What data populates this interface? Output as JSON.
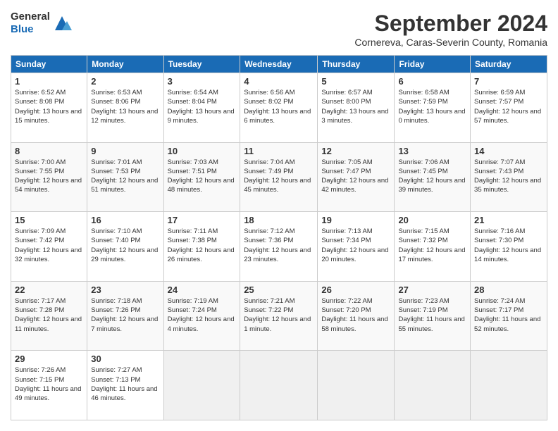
{
  "logo": {
    "general": "General",
    "blue": "Blue"
  },
  "title": "September 2024",
  "subtitle": "Cornereva, Caras-Severin County, Romania",
  "days_of_week": [
    "Sunday",
    "Monday",
    "Tuesday",
    "Wednesday",
    "Thursday",
    "Friday",
    "Saturday"
  ],
  "weeks": [
    [
      {
        "day": "1",
        "sunrise": "6:52 AM",
        "sunset": "8:08 PM",
        "daylight": "13 hours and 15 minutes."
      },
      {
        "day": "2",
        "sunrise": "6:53 AM",
        "sunset": "8:06 PM",
        "daylight": "13 hours and 12 minutes."
      },
      {
        "day": "3",
        "sunrise": "6:54 AM",
        "sunset": "8:04 PM",
        "daylight": "13 hours and 9 minutes."
      },
      {
        "day": "4",
        "sunrise": "6:56 AM",
        "sunset": "8:02 PM",
        "daylight": "13 hours and 6 minutes."
      },
      {
        "day": "5",
        "sunrise": "6:57 AM",
        "sunset": "8:00 PM",
        "daylight": "13 hours and 3 minutes."
      },
      {
        "day": "6",
        "sunrise": "6:58 AM",
        "sunset": "7:59 PM",
        "daylight": "13 hours and 0 minutes."
      },
      {
        "day": "7",
        "sunrise": "6:59 AM",
        "sunset": "7:57 PM",
        "daylight": "12 hours and 57 minutes."
      }
    ],
    [
      {
        "day": "8",
        "sunrise": "7:00 AM",
        "sunset": "7:55 PM",
        "daylight": "12 hours and 54 minutes."
      },
      {
        "day": "9",
        "sunrise": "7:01 AM",
        "sunset": "7:53 PM",
        "daylight": "12 hours and 51 minutes."
      },
      {
        "day": "10",
        "sunrise": "7:03 AM",
        "sunset": "7:51 PM",
        "daylight": "12 hours and 48 minutes."
      },
      {
        "day": "11",
        "sunrise": "7:04 AM",
        "sunset": "7:49 PM",
        "daylight": "12 hours and 45 minutes."
      },
      {
        "day": "12",
        "sunrise": "7:05 AM",
        "sunset": "7:47 PM",
        "daylight": "12 hours and 42 minutes."
      },
      {
        "day": "13",
        "sunrise": "7:06 AM",
        "sunset": "7:45 PM",
        "daylight": "12 hours and 39 minutes."
      },
      {
        "day": "14",
        "sunrise": "7:07 AM",
        "sunset": "7:43 PM",
        "daylight": "12 hours and 35 minutes."
      }
    ],
    [
      {
        "day": "15",
        "sunrise": "7:09 AM",
        "sunset": "7:42 PM",
        "daylight": "12 hours and 32 minutes."
      },
      {
        "day": "16",
        "sunrise": "7:10 AM",
        "sunset": "7:40 PM",
        "daylight": "12 hours and 29 minutes."
      },
      {
        "day": "17",
        "sunrise": "7:11 AM",
        "sunset": "7:38 PM",
        "daylight": "12 hours and 26 minutes."
      },
      {
        "day": "18",
        "sunrise": "7:12 AM",
        "sunset": "7:36 PM",
        "daylight": "12 hours and 23 minutes."
      },
      {
        "day": "19",
        "sunrise": "7:13 AM",
        "sunset": "7:34 PM",
        "daylight": "12 hours and 20 minutes."
      },
      {
        "day": "20",
        "sunrise": "7:15 AM",
        "sunset": "7:32 PM",
        "daylight": "12 hours and 17 minutes."
      },
      {
        "day": "21",
        "sunrise": "7:16 AM",
        "sunset": "7:30 PM",
        "daylight": "12 hours and 14 minutes."
      }
    ],
    [
      {
        "day": "22",
        "sunrise": "7:17 AM",
        "sunset": "7:28 PM",
        "daylight": "12 hours and 11 minutes."
      },
      {
        "day": "23",
        "sunrise": "7:18 AM",
        "sunset": "7:26 PM",
        "daylight": "12 hours and 7 minutes."
      },
      {
        "day": "24",
        "sunrise": "7:19 AM",
        "sunset": "7:24 PM",
        "daylight": "12 hours and 4 minutes."
      },
      {
        "day": "25",
        "sunrise": "7:21 AM",
        "sunset": "7:22 PM",
        "daylight": "12 hours and 1 minute."
      },
      {
        "day": "26",
        "sunrise": "7:22 AM",
        "sunset": "7:20 PM",
        "daylight": "11 hours and 58 minutes."
      },
      {
        "day": "27",
        "sunrise": "7:23 AM",
        "sunset": "7:19 PM",
        "daylight": "11 hours and 55 minutes."
      },
      {
        "day": "28",
        "sunrise": "7:24 AM",
        "sunset": "7:17 PM",
        "daylight": "11 hours and 52 minutes."
      }
    ],
    [
      {
        "day": "29",
        "sunrise": "7:26 AM",
        "sunset": "7:15 PM",
        "daylight": "11 hours and 49 minutes."
      },
      {
        "day": "30",
        "sunrise": "7:27 AM",
        "sunset": "7:13 PM",
        "daylight": "11 hours and 46 minutes."
      },
      null,
      null,
      null,
      null,
      null
    ]
  ]
}
